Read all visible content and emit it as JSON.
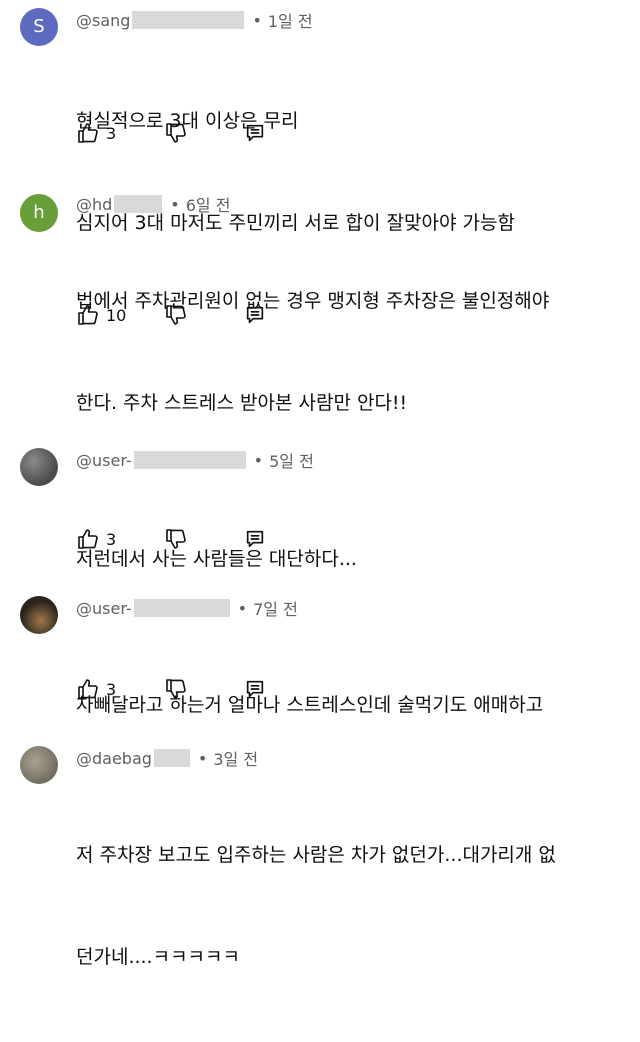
{
  "comments": [
    {
      "avatar_letter": "S",
      "avatar_color": "#5c6bc0",
      "handle": "@sang",
      "time": "1일 전",
      "lines": [
        "현실적으로 3대 이상은 무리",
        "심지어 3대 마저도 주민끼리 서로 합이 잘맞아야 가능함"
      ],
      "likes": "3"
    },
    {
      "avatar_letter": "h",
      "avatar_color": "#689f38",
      "handle": "@hd",
      "time": "6일 전",
      "lines": [
        "법에서 주차관리원이 없는 경우 맹지형 주차장은 불인정해야",
        "한다. 주차 스트레스 받아본 사람만 안다!!"
      ],
      "likes": "10"
    },
    {
      "avatar_letter": "",
      "avatar_color": "#6b6b6b",
      "handle": "@user-",
      "time": "5일 전",
      "lines": [
        "저런데서 사는 사람들은 대단하다..."
      ],
      "likes": "3"
    },
    {
      "avatar_letter": "",
      "avatar_color": "#3a3328",
      "handle": "@user-",
      "time": "7일 전",
      "lines": [
        "차빼달라고 하는거 얼마나 스트레스인데 술먹기도 애매하고"
      ],
      "likes": "3"
    },
    {
      "avatar_letter": "",
      "avatar_color": "#8a8472",
      "handle": "@daebag",
      "time": "3일 전",
      "lines": [
        "저 주차장 보고도 입주하는 사람은 차가 없던가...대가리개 없",
        "던가네....ㅋㅋㅋㅋㅋ"
      ],
      "likes": ""
    }
  ]
}
